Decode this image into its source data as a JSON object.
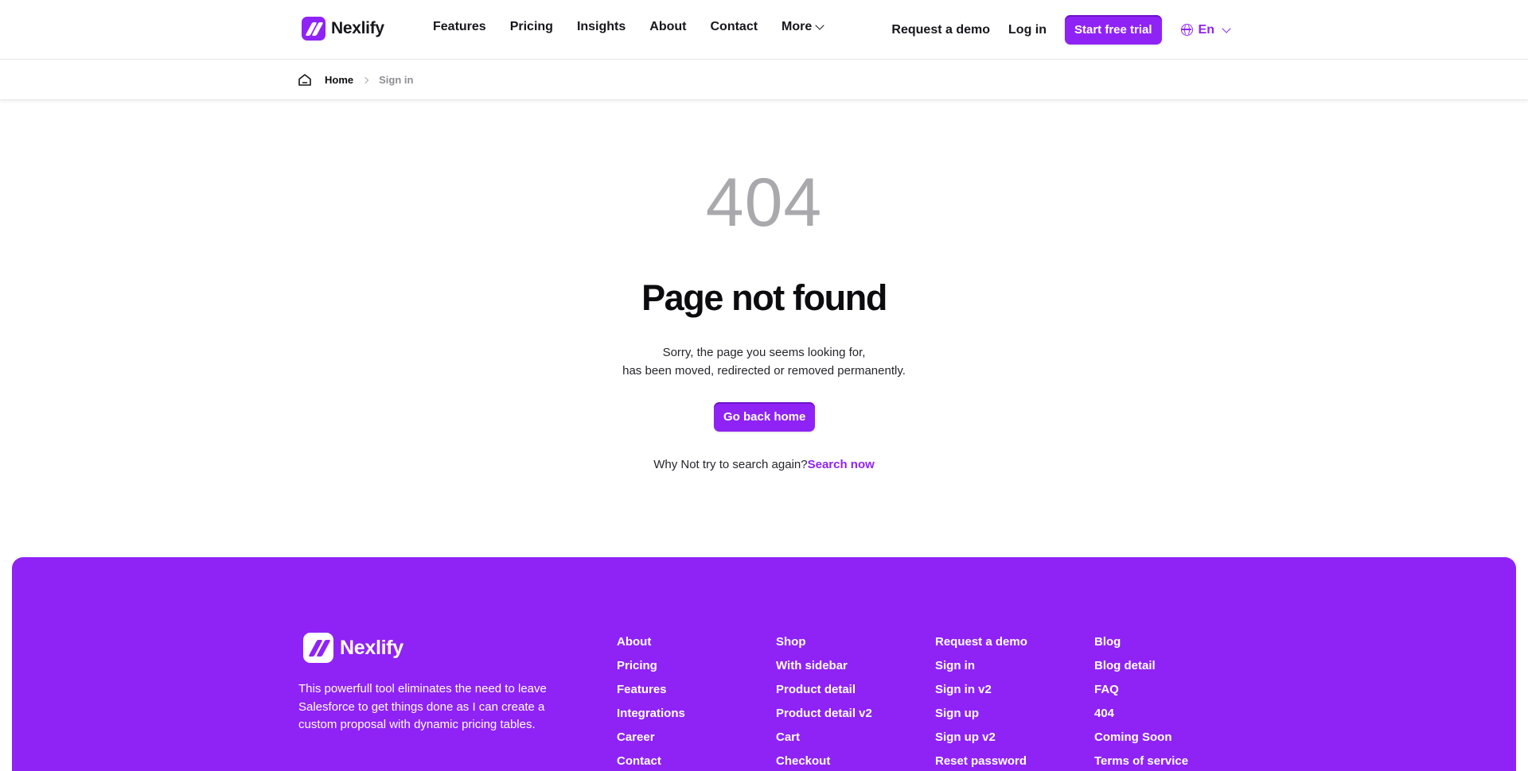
{
  "header": {
    "brand": "Nexlify",
    "nav": [
      {
        "label": "Features"
      },
      {
        "label": "Pricing"
      },
      {
        "label": "Insights"
      },
      {
        "label": "About"
      },
      {
        "label": "Contact"
      },
      {
        "label": "More"
      }
    ],
    "request_demo": "Request a demo",
    "login": "Log in",
    "trial": "Start free trial",
    "language": "En"
  },
  "breadcrumb": {
    "home": "Home",
    "current": "Sign in"
  },
  "error": {
    "code": "404",
    "title": "Page not found",
    "line1": "Sorry, the page you seems looking for,",
    "line2": "has been moved, redirected or removed permanently.",
    "button": "Go back home",
    "retry_text": "Why Not try to search again?",
    "retry_link": "Search now"
  },
  "footer": {
    "brand": "Nexlify",
    "tagline": "This powerfull tool eliminates the need to leave Salesforce to get things done as I can create a custom proposal with dynamic pricing tables.",
    "columns": [
      [
        "About",
        "Pricing",
        "Features",
        "Integrations",
        "Career",
        "Contact"
      ],
      [
        "Shop",
        "With sidebar",
        "Product detail",
        "Product detail v2",
        "Cart",
        "Checkout"
      ],
      [
        "Request a demo",
        "Sign in",
        "Sign in v2",
        "Sign up",
        "Sign up v2",
        "Reset password"
      ],
      [
        "Blog",
        "Blog detail",
        "FAQ",
        "404",
        "Coming Soon",
        "Terms of service"
      ]
    ]
  },
  "colors": {
    "accent": "#8f23f5",
    "muted_code": "#a9a9ad",
    "text": "#0c0c10"
  }
}
